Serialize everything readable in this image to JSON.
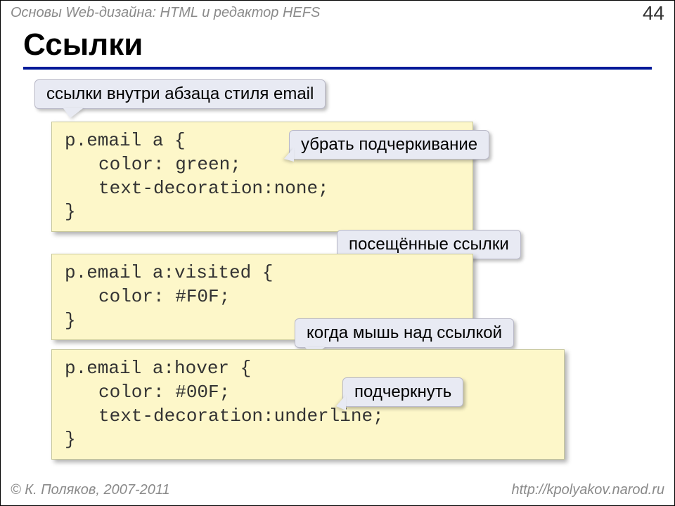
{
  "header": {
    "course_title": "Основы Web-дизайна: HTML и редактор HEFS",
    "page_number": "44"
  },
  "title": "Ссылки",
  "callouts": {
    "c1": "ссылки внутри абзаца стиля email",
    "c2": "убрать подчеркивание",
    "c3": "посещённые ссылки",
    "c4": "когда мышь над ссылкой",
    "c5": "подчеркнуть"
  },
  "code1": {
    "l1": "p.email a {",
    "l2": "color: green;",
    "l3": "text-decoration:none;",
    "l4": "}"
  },
  "code2": {
    "l1": "p.email a:visited {",
    "l2": "color: #F0F;",
    "l3": "}"
  },
  "code3": {
    "l1": "p.email a:hover {",
    "l2": "color: #00F;",
    "l3": "text-decoration:underline;",
    "l4": "}"
  },
  "footer": {
    "left": "© К. Поляков, 2007-2011",
    "right": "http://kpolyakov.narod.ru"
  }
}
